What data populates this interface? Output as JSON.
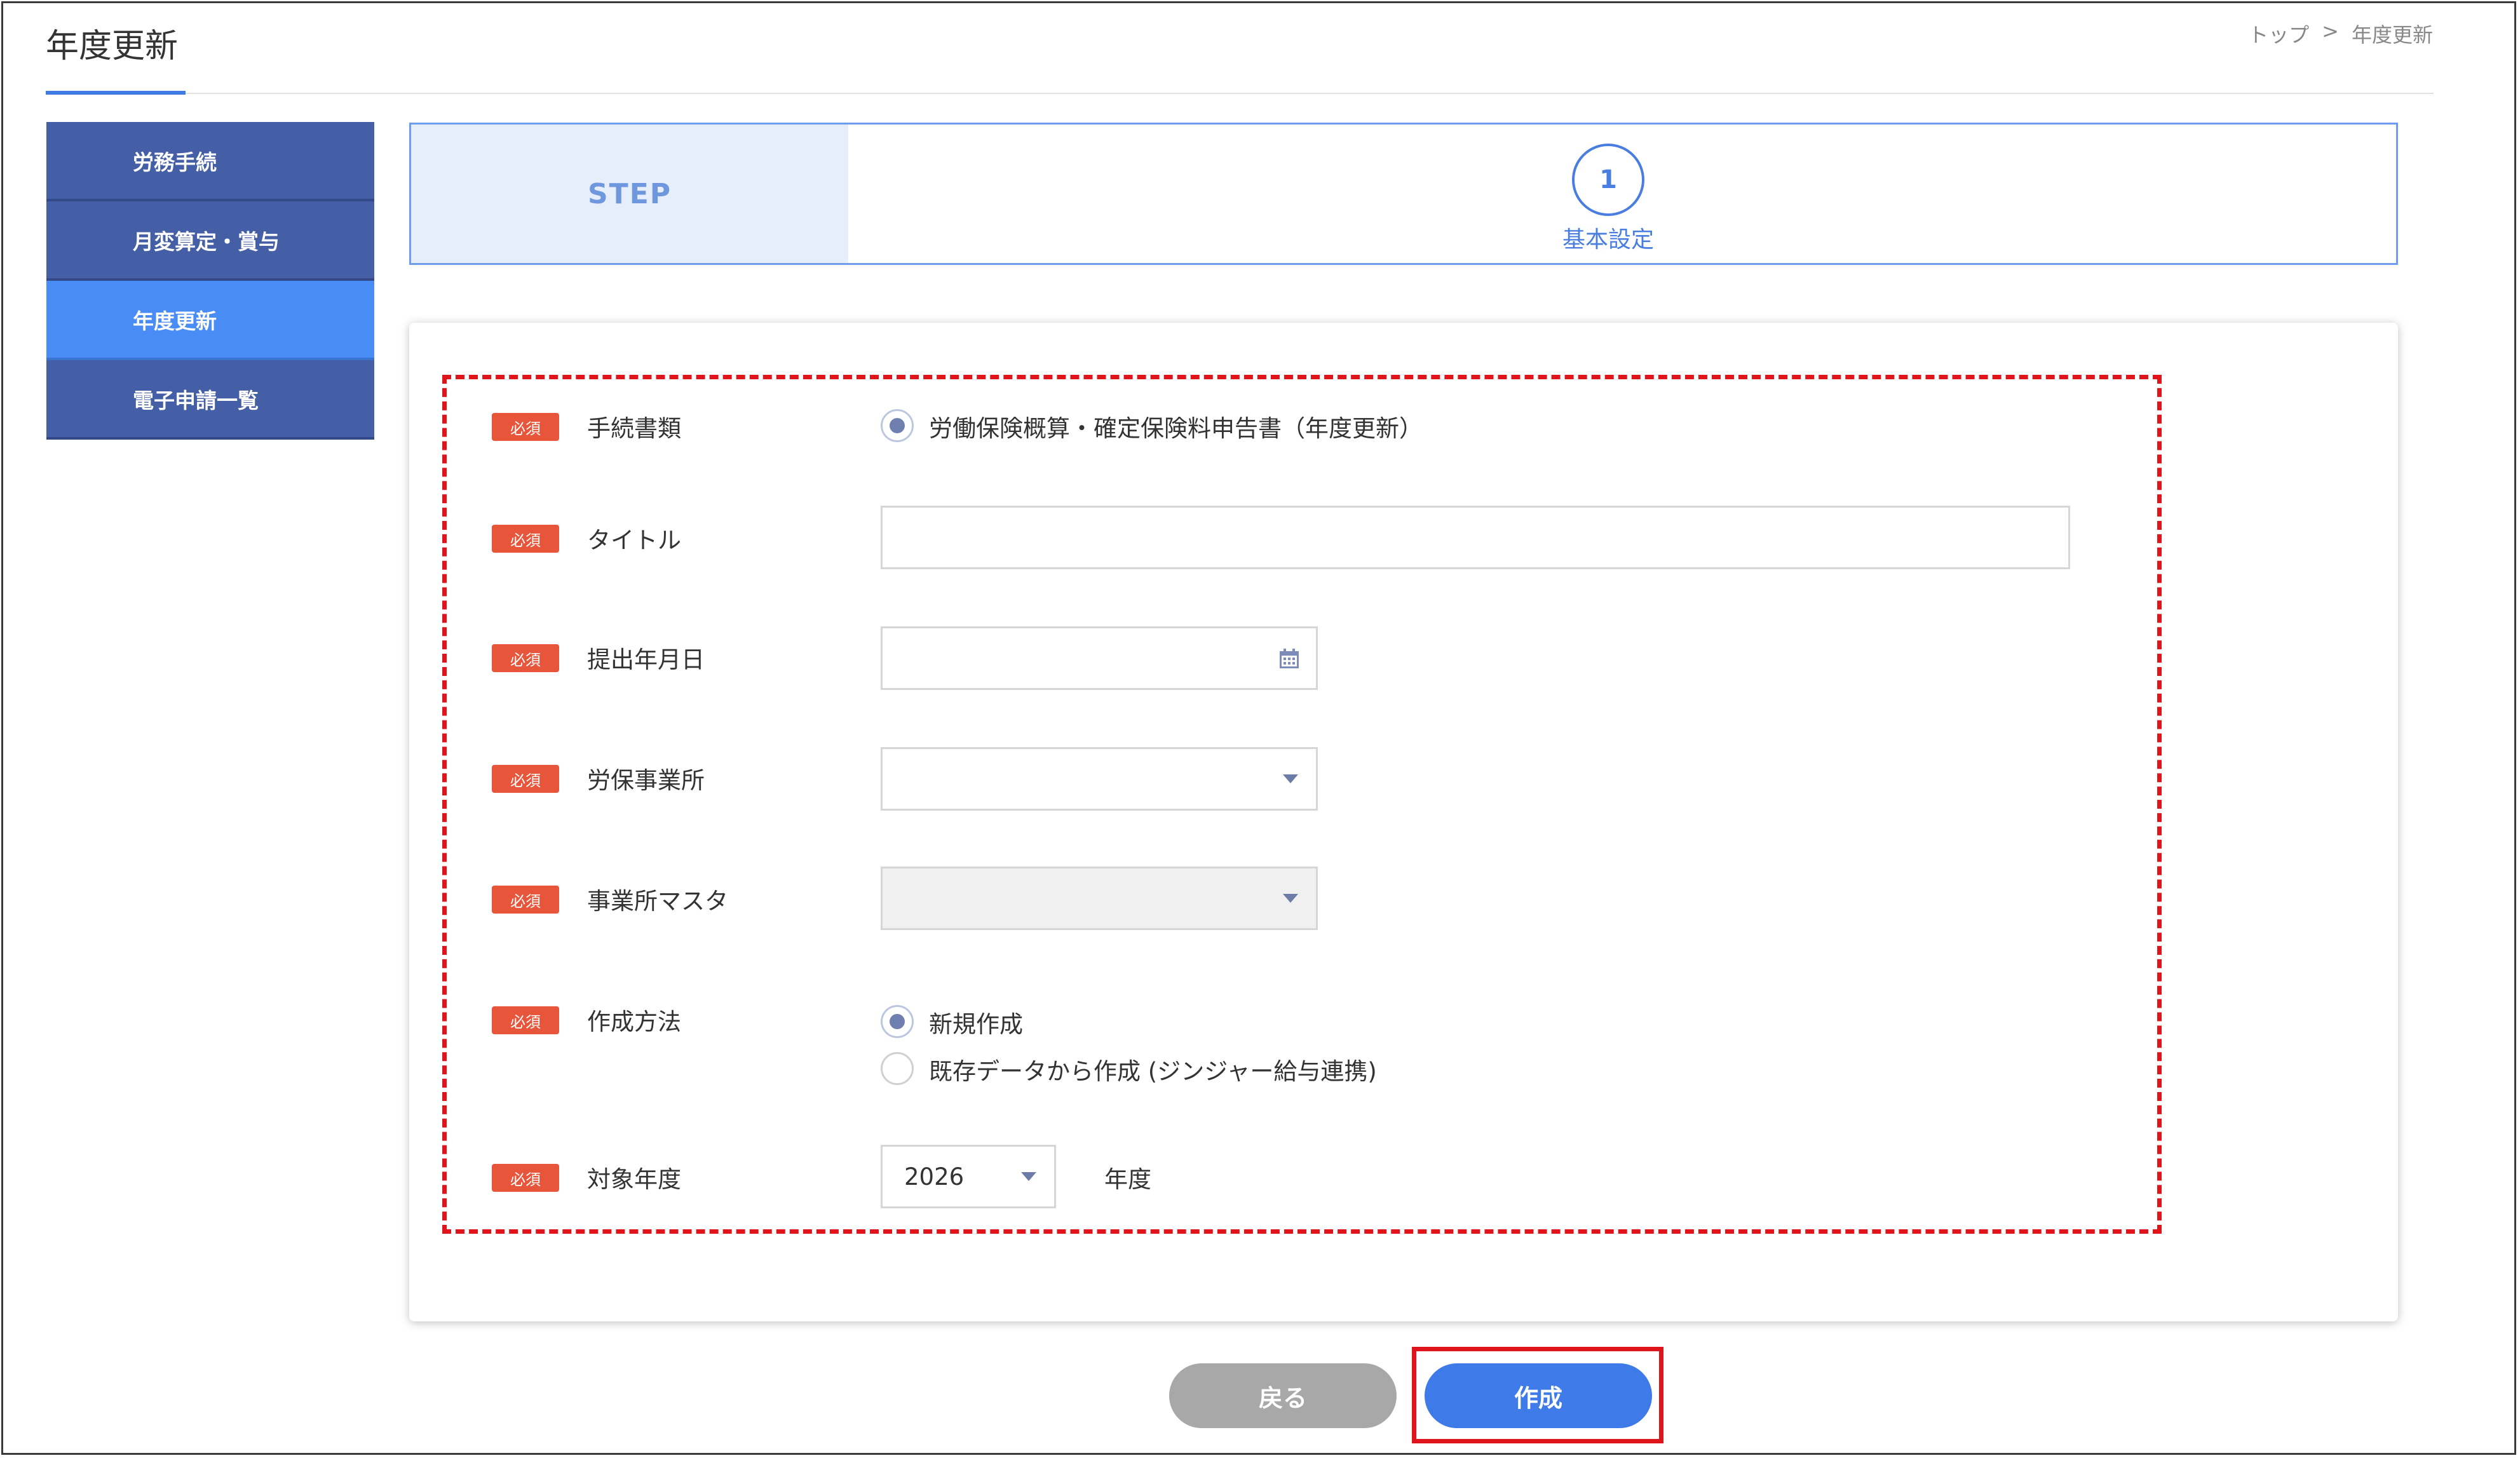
{
  "page": {
    "title": "年度更新"
  },
  "breadcrumb": {
    "home": "トップ",
    "separator": ">",
    "current": "年度更新"
  },
  "sidebar": {
    "items": [
      {
        "label": "労務手続",
        "active": false
      },
      {
        "label": "月変算定・賞与",
        "active": false
      },
      {
        "label": "年度更新",
        "active": true
      },
      {
        "label": "電子申請一覧",
        "active": false
      }
    ]
  },
  "steps": {
    "label": "STEP",
    "current": {
      "number": "1",
      "name": "基本設定"
    }
  },
  "form": {
    "required_badge": "必須",
    "procedure": {
      "label": "手続書類",
      "option": "労働保険概算・確定保険料申告書（年度更新）",
      "selected": true
    },
    "title": {
      "label": "タイトル",
      "value": "",
      "placeholder": ""
    },
    "submit_date": {
      "label": "提出年月日",
      "value": "",
      "icon": "calendar-icon"
    },
    "labor_office": {
      "label": "労保事業所",
      "value": "",
      "icon": "chevron-down-icon"
    },
    "office_master": {
      "label": "事業所マスタ",
      "value": "",
      "disabled": true,
      "icon": "chevron-down-icon"
    },
    "method": {
      "label": "作成方法",
      "options": [
        {
          "label": "新規作成",
          "selected": true
        },
        {
          "label": "既存データから作成 (ジンジャー給与連携)",
          "selected": false
        }
      ]
    },
    "target_year": {
      "label": "対象年度",
      "value": "2026",
      "suffix": "年度"
    }
  },
  "buttons": {
    "back": "戻る",
    "create": "作成"
  },
  "colors": {
    "accent": "#3f7be8",
    "sidebar": "#445fa6",
    "sidebar_active": "#4a8cf5",
    "required": "#e7553a",
    "highlight": "#e0141b"
  }
}
